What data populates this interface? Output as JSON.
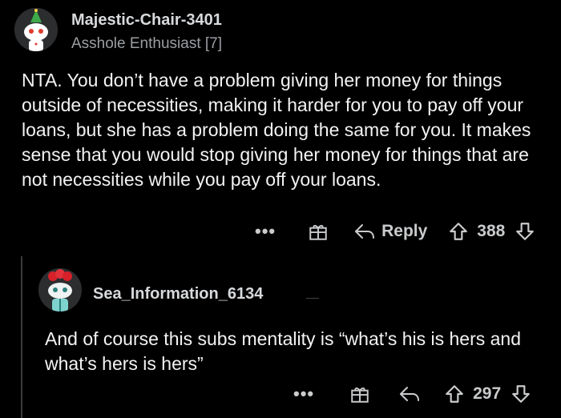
{
  "comment": {
    "username": "Majestic-Chair-3401",
    "flair": "Asshole Enthusiast [7]",
    "body": "NTA. You don’t have a problem giving her money for things outside of necessities, making it harder for you to pay off your loans, but she has a problem doing the same for you. It makes sense that you would stop giving her money for things that are not necessities while you pay off your loans.",
    "more_label": "•••",
    "reply_label": "Reply",
    "score": "388"
  },
  "reply": {
    "username": "Sea_Information_6134",
    "body": "And of course this subs mentality is “what’s his is hers and what’s hers is hers”",
    "more_label": "•••",
    "score": "297"
  },
  "icons": {
    "gift": "gift-icon",
    "reply": "reply-arrow-icon",
    "upvote": "upvote-icon",
    "downvote": "downvote-icon"
  }
}
